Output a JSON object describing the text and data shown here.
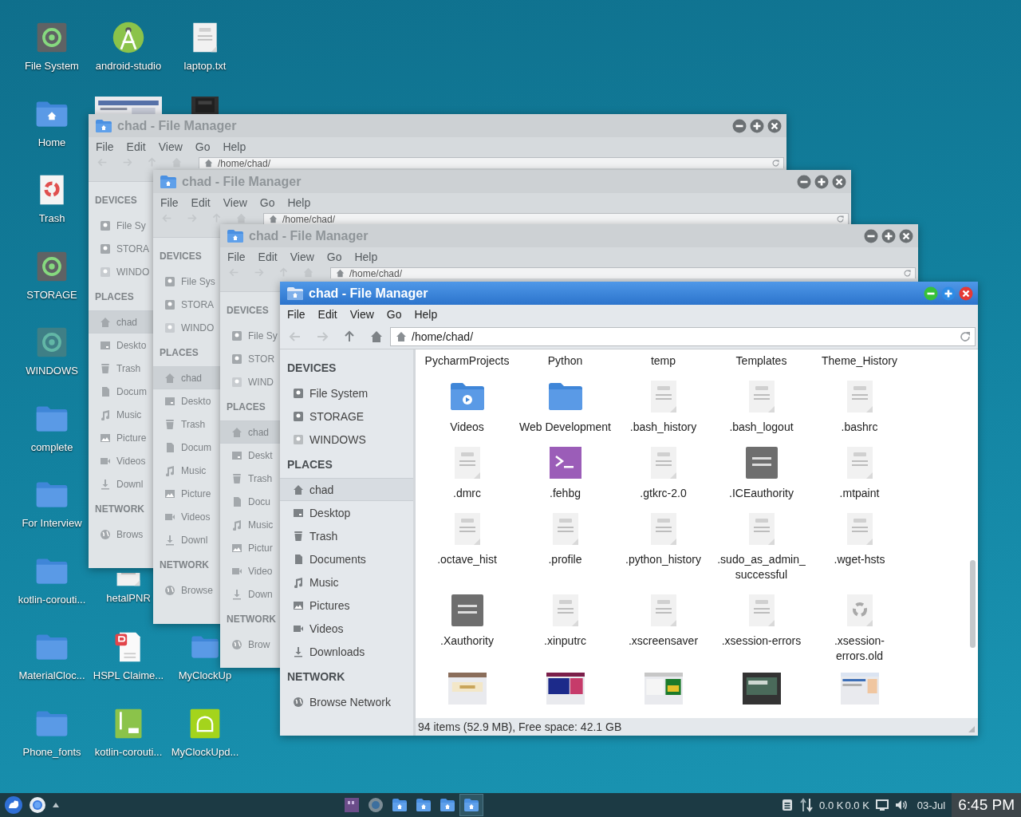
{
  "desktop": {
    "columns": [
      [
        {
          "label": "File System",
          "kind": "drive",
          "mounted": true
        },
        {
          "label": "Home",
          "kind": "home-folder"
        },
        {
          "label": "Trash",
          "kind": "trash"
        },
        {
          "label": "STORAGE",
          "kind": "drive",
          "mounted": true
        },
        {
          "label": "WINDOWS",
          "kind": "drive",
          "mounted": false
        },
        {
          "label": "complete",
          "kind": "folder"
        },
        {
          "label": "For Interview",
          "kind": "folder"
        },
        {
          "label": "kotlin-corouti...",
          "kind": "folder"
        },
        {
          "label": "MaterialCloc...",
          "kind": "folder"
        },
        {
          "label": "Phone_fonts",
          "kind": "folder"
        }
      ],
      [
        {
          "label": "android-studio",
          "kind": "app"
        },
        {
          "kind": "picture"
        },
        {
          "label": "hetalPNR",
          "kind": "text"
        },
        {
          "label": "HSPL Claime...",
          "kind": "pdf"
        },
        {
          "label": "kotlin-corouti...",
          "kind": "zip"
        }
      ],
      [
        {
          "label": "laptop.txt",
          "kind": "text"
        },
        {
          "kind": "dark-picture"
        },
        {
          "label": "MyClockUp",
          "kind": "folder"
        },
        {
          "label": "MyClockUpd...",
          "kind": "apk"
        }
      ]
    ]
  },
  "windows": [
    {
      "title": "chad - File Manager",
      "active": false,
      "menu": [
        "File",
        "Edit",
        "View",
        "Go",
        "Help"
      ],
      "nav": [
        {
          "kind": "back",
          "disabled": true
        },
        {
          "kind": "forward",
          "disabled": true
        },
        {
          "kind": "up",
          "disabled": true
        },
        {
          "kind": "home",
          "disabled": true
        }
      ],
      "path": "/home/chad/",
      "sidebar": [
        {
          "heading": "DEVICES",
          "items": [
            {
              "label": "File Sy",
              "kind": "drive",
              "mounted": true,
              "selected": false
            },
            {
              "label": "STORA",
              "kind": "drive",
              "mounted": true,
              "selected": false
            },
            {
              "label": "WINDO",
              "kind": "drive",
              "mounted": false,
              "selected": false
            }
          ]
        },
        {
          "heading": "PLACES",
          "items": [
            {
              "label": "chad",
              "kind": "home",
              "selected": true
            },
            {
              "label": "Deskto",
              "kind": "desktop",
              "selected": false
            },
            {
              "label": "Trash",
              "kind": "trash",
              "selected": false
            },
            {
              "label": "Docum",
              "kind": "document",
              "selected": false
            },
            {
              "label": "Music",
              "kind": "music",
              "selected": false
            },
            {
              "label": "Picture",
              "kind": "picture",
              "selected": false
            },
            {
              "label": "Videos",
              "kind": "video",
              "selected": false
            },
            {
              "label": "Downl",
              "kind": "download",
              "selected": false
            }
          ]
        },
        {
          "heading": "NETWORK",
          "items": [
            {
              "label": "Brows",
              "kind": "network",
              "selected": false
            }
          ]
        }
      ]
    },
    {
      "title": "chad - File Manager",
      "active": false,
      "menu": [
        "File",
        "Edit",
        "View",
        "Go",
        "Help"
      ],
      "nav": [
        {
          "kind": "back",
          "disabled": true
        },
        {
          "kind": "forward",
          "disabled": true
        },
        {
          "kind": "up",
          "disabled": true
        },
        {
          "kind": "home",
          "disabled": true
        }
      ],
      "path": "/home/chad/",
      "sidebar": [
        {
          "heading": "DEVICES",
          "items": [
            {
              "label": "File Sys",
              "kind": "drive",
              "mounted": true,
              "selected": false
            },
            {
              "label": "STORA",
              "kind": "drive",
              "mounted": true,
              "selected": false
            },
            {
              "label": "WINDO",
              "kind": "drive",
              "mounted": false,
              "selected": false
            }
          ]
        },
        {
          "heading": "PLACES",
          "items": [
            {
              "label": "chad",
              "kind": "home",
              "selected": true
            },
            {
              "label": "Deskto",
              "kind": "desktop",
              "selected": false
            },
            {
              "label": "Trash",
              "kind": "trash",
              "selected": false
            },
            {
              "label": "Docum",
              "kind": "document",
              "selected": false
            },
            {
              "label": "Music",
              "kind": "music",
              "selected": false
            },
            {
              "label": "Picture",
              "kind": "picture",
              "selected": false
            },
            {
              "label": "Videos",
              "kind": "video",
              "selected": false
            },
            {
              "label": "Downl",
              "kind": "download",
              "selected": false
            }
          ]
        },
        {
          "heading": "NETWORK",
          "items": [
            {
              "label": "Browse",
              "kind": "network",
              "selected": false
            }
          ]
        }
      ]
    },
    {
      "title": "chad - File Manager",
      "active": false,
      "menu": [
        "File",
        "Edit",
        "View",
        "Go",
        "Help"
      ],
      "nav": [
        {
          "kind": "back",
          "disabled": true
        },
        {
          "kind": "forward",
          "disabled": true
        },
        {
          "kind": "up",
          "disabled": true
        },
        {
          "kind": "home",
          "disabled": true
        }
      ],
      "path": "/home/chad/",
      "sidebar": [
        {
          "heading": "DEVICES",
          "items": [
            {
              "label": "File Sy",
              "kind": "drive",
              "mounted": true,
              "selected": false
            },
            {
              "label": "STOR",
              "kind": "drive",
              "mounted": true,
              "selected": false
            },
            {
              "label": "WIND",
              "kind": "drive",
              "mounted": false,
              "selected": false
            }
          ]
        },
        {
          "heading": "PLACES",
          "items": [
            {
              "label": "chad",
              "kind": "home",
              "selected": true
            },
            {
              "label": "Deskt",
              "kind": "desktop",
              "selected": false
            },
            {
              "label": "Trash",
              "kind": "trash",
              "selected": false
            },
            {
              "label": "Docu",
              "kind": "document",
              "selected": false
            },
            {
              "label": "Music",
              "kind": "music",
              "selected": false
            },
            {
              "label": "Pictur",
              "kind": "picture",
              "selected": false
            },
            {
              "label": "Video",
              "kind": "video",
              "selected": false
            },
            {
              "label": "Down",
              "kind": "download",
              "selected": false
            }
          ]
        },
        {
          "heading": "NETWORK",
          "items": [
            {
              "label": "Brow",
              "kind": "network",
              "selected": false
            }
          ]
        }
      ]
    },
    {
      "title": "chad - File Manager",
      "active": true,
      "menu": [
        "File",
        "Edit",
        "View",
        "Go",
        "Help"
      ],
      "nav": [
        {
          "kind": "back",
          "disabled": true
        },
        {
          "kind": "forward",
          "disabled": true
        },
        {
          "kind": "up",
          "disabled": false
        },
        {
          "kind": "home",
          "disabled": false
        }
      ],
      "path": "/home/chad/",
      "sidebar": [
        {
          "heading": "DEVICES",
          "items": [
            {
              "label": "File System",
              "kind": "drive",
              "mounted": true,
              "selected": false
            },
            {
              "label": "STORAGE",
              "kind": "drive",
              "mounted": true,
              "selected": false
            },
            {
              "label": "WINDOWS",
              "kind": "drive",
              "mounted": false,
              "selected": false
            }
          ]
        },
        {
          "heading": "PLACES",
          "items": [
            {
              "label": "chad",
              "kind": "home",
              "selected": true
            },
            {
              "label": "Desktop",
              "kind": "desktop",
              "selected": false
            },
            {
              "label": "Trash",
              "kind": "trash",
              "selected": false
            },
            {
              "label": "Documents",
              "kind": "document",
              "selected": false
            },
            {
              "label": "Music",
              "kind": "music",
              "selected": false
            },
            {
              "label": "Pictures",
              "kind": "picture",
              "selected": false
            },
            {
              "label": "Videos",
              "kind": "video",
              "selected": false
            },
            {
              "label": "Downloads",
              "kind": "download",
              "selected": false
            }
          ]
        },
        {
          "heading": "NETWORK",
          "items": [
            {
              "label": "Browse Network",
              "kind": "network",
              "selected": false
            }
          ]
        }
      ],
      "files": [
        {
          "name": "PycharmProjects"
        },
        {
          "name": "Python"
        },
        {
          "name": "temp"
        },
        {
          "name": "Templates"
        },
        {
          "name": "Theme_History"
        },
        {
          "name": "Videos",
          "kind": "video-folder"
        },
        {
          "name": "Web Development",
          "kind": "folder"
        },
        {
          "name": ".bash_history",
          "kind": "text"
        },
        {
          "name": ".bash_logout",
          "kind": "text"
        },
        {
          "name": ".bashrc",
          "kind": "text"
        },
        {
          "name": ".dmrc",
          "kind": "text"
        },
        {
          "name": ".fehbg",
          "kind": "script"
        },
        {
          "name": ".gtkrc-2.0",
          "kind": "text"
        },
        {
          "name": ".ICEauthority",
          "kind": "binary"
        },
        {
          "name": ".mtpaint",
          "kind": "text"
        },
        {
          "name": ".octave_hist",
          "kind": "text"
        },
        {
          "name": ".profile",
          "kind": "text"
        },
        {
          "name": ".python_history",
          "kind": "text"
        },
        {
          "name": ".sudo_as_admin_successful",
          "kind": "text"
        },
        {
          "name": ".wget-hsts",
          "kind": "text"
        },
        {
          "name": ".Xauthority",
          "kind": "binary"
        },
        {
          "name": ".xinputrc",
          "kind": "text"
        },
        {
          "name": ".xscreensaver",
          "kind": "text"
        },
        {
          "name": ".xsession-errors",
          "kind": "text"
        },
        {
          "name": ".xsession-errors.old",
          "kind": "recycle"
        },
        {
          "kind": "picture"
        },
        {
          "kind": "picture"
        },
        {
          "kind": "picture"
        },
        {
          "kind": "picture"
        },
        {
          "kind": "picture"
        }
      ],
      "status": "94 items (52.9 MB), Free space: 42.1 GB"
    }
  ],
  "taskbar": {
    "tasks": [
      {
        "kind": "editor",
        "selected": false
      },
      {
        "kind": "browser",
        "selected": false
      },
      {
        "kind": "folder",
        "selected": false
      },
      {
        "kind": "folder",
        "selected": false
      },
      {
        "kind": "folder",
        "selected": false
      },
      {
        "kind": "folder",
        "selected": true
      }
    ],
    "net_down": "0.0 K",
    "net_up": "0.0 K",
    "date": "03-Jul",
    "time": "6:45 PM"
  }
}
